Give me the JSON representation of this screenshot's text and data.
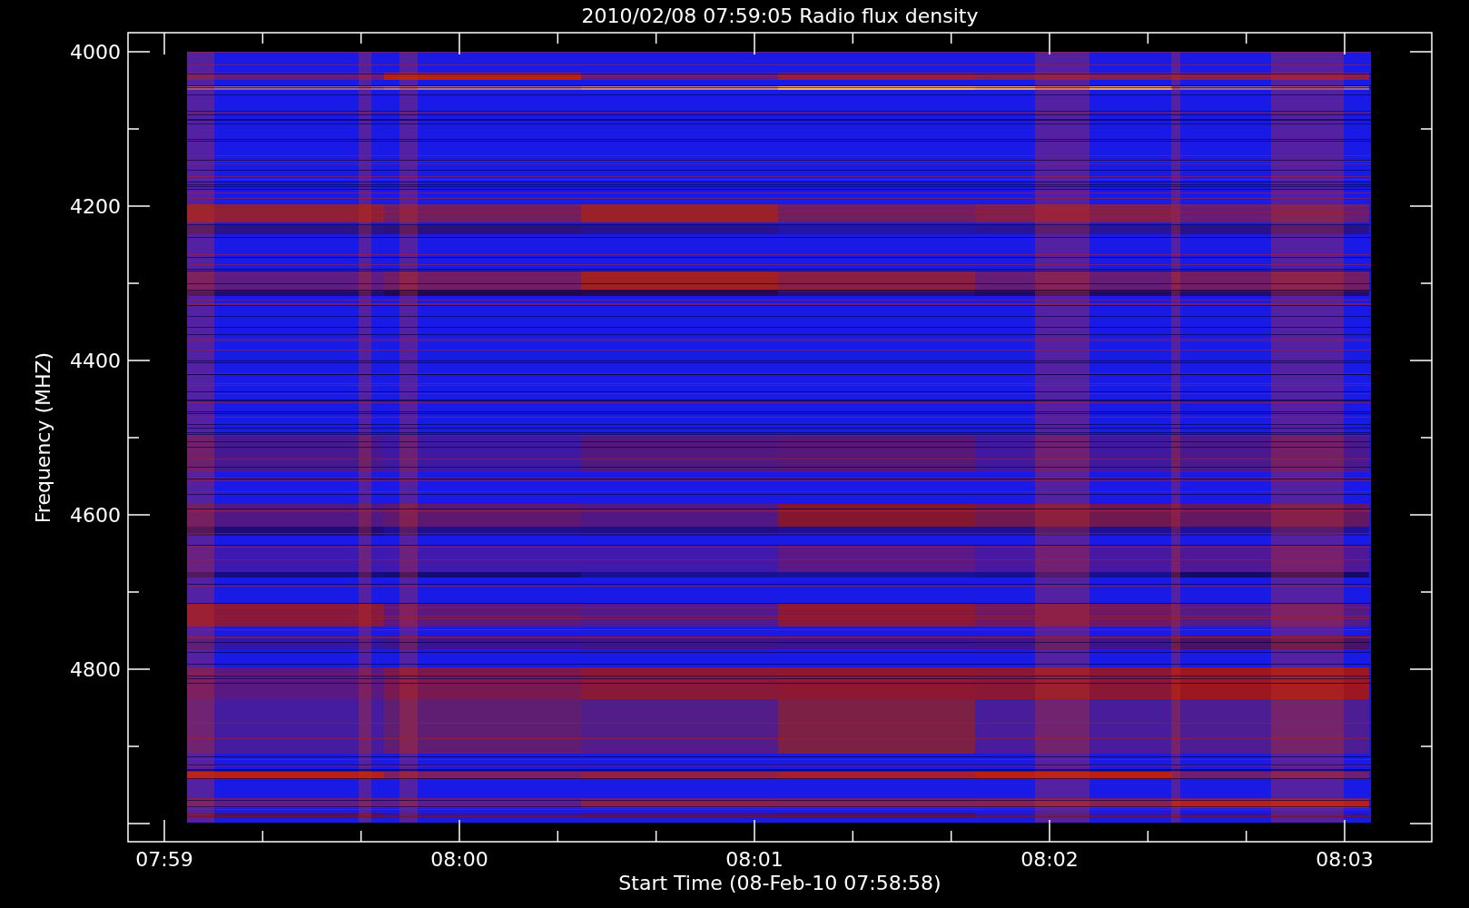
{
  "title": "2010/02/08 07:59:05 Radio flux density",
  "y_axis": {
    "label": "Frequency (MHZ)",
    "ticks": [
      "4000",
      "4200",
      "4400",
      "4600",
      "4800"
    ]
  },
  "x_axis": {
    "label": "Start Time (08-Feb-10 07:58:58)",
    "ticks": [
      "07:59",
      "08:00",
      "08:01",
      "08:02",
      "08:03"
    ]
  }
}
